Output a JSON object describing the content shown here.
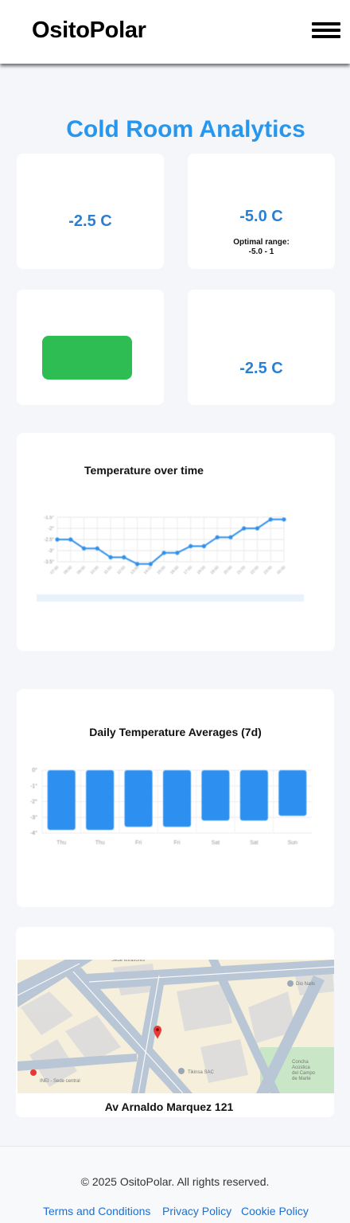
{
  "header": {
    "brand": "OsitoPolar"
  },
  "main": {
    "title": "Cold Room Analytics",
    "current_temperature": "-2.5 C",
    "target_temperature": "-5.0 C",
    "optimal_range_label": "Optimal range:",
    "optimal_range_value": "-5.0 - 1",
    "status_color": "#2dbd52",
    "average_temperature": "-2.5 C"
  },
  "colors": {
    "accent": "#2696ee",
    "value": "#2a7fd1",
    "status_ok": "#2dbd52",
    "link": "#1d6fd0"
  },
  "chart_data": [
    {
      "type": "line",
      "title": "Temperature over time",
      "x": [
        "07:00",
        "08:00",
        "09:00",
        "10:00",
        "11:00",
        "12:00",
        "13:00",
        "14:00",
        "15:00",
        "16:00",
        "17:00",
        "18:00",
        "19:00",
        "20:00",
        "21:00",
        "22:00",
        "23:00",
        "00:00"
      ],
      "values": [
        -2.5,
        -2.5,
        -2.9,
        -2.9,
        -3.3,
        -3.3,
        -3.6,
        -3.6,
        -3.1,
        -3.1,
        -2.8,
        -2.8,
        -2.4,
        -2.4,
        -2.0,
        -2.0,
        -1.6,
        -1.6
      ],
      "ylim": [
        -3.5,
        -1.5
      ],
      "ytick_labels": [
        "-1.5°",
        "-2°",
        "-2.5°",
        "-3°",
        "-3.5°"
      ],
      "grid": true,
      "color": "#2f8fea"
    },
    {
      "type": "bar",
      "title": "Daily Temperature Averages (7d)",
      "categories": [
        "Thu",
        "Thu",
        "Fri",
        "Fri",
        "Sat",
        "Sat",
        "Sun"
      ],
      "values": [
        -3.8,
        -3.8,
        -3.6,
        -3.6,
        -3.2,
        -3.2,
        -2.9
      ],
      "ylim": [
        -4,
        0
      ],
      "ytick_labels": [
        "0°",
        "-1°",
        "-2°",
        "-3°",
        "-4°"
      ],
      "grid": true,
      "color": "#2d8ff0"
    }
  ],
  "map": {
    "address": "Av Arnaldo Marquez 121",
    "labels": [
      "Sede Miraflores",
      "Dio Nails",
      "INEI - Sede central",
      "Tikinsa SAC",
      "Concha Acústica del Campo de Marte"
    ],
    "marker_icon": "map-pin-icon"
  },
  "footer": {
    "copyright": "© 2025 OsitoPolar. All rights reserved.",
    "links": [
      "Terms and Conditions",
      "Privacy Policy",
      "Cookie Policy"
    ]
  }
}
